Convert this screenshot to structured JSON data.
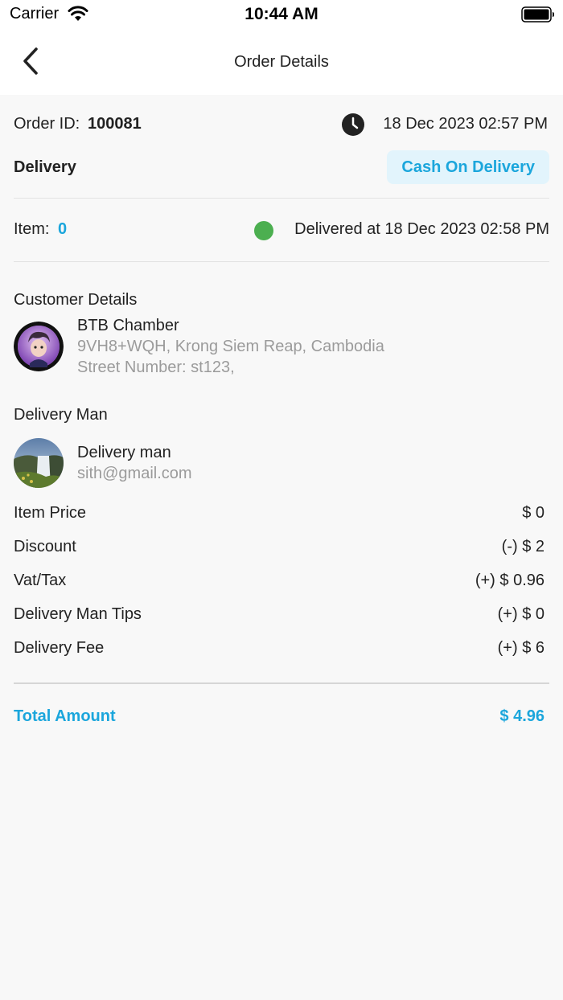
{
  "status_bar": {
    "carrier": "Carrier",
    "time": "10:44 AM",
    "wifi_icon": "wifi-icon",
    "battery_icon": "battery-icon"
  },
  "header": {
    "title": "Order Details",
    "back_icon": "chevron-left-icon"
  },
  "order": {
    "id_label": "Order ID:",
    "id_value": "100081",
    "clock_icon": "clock-icon",
    "datetime": "18 Dec 2023  02:57 PM",
    "delivery_type": "Delivery",
    "payment_method": "Cash On Delivery",
    "items_label": "Item:",
    "items_count": "0",
    "delivered_text": "Delivered at 18 Dec 2023  02:58 PM"
  },
  "customer": {
    "section_title": "Customer Details",
    "name": "BTB Chamber",
    "address": "9VH8+WQH, Krong Siem Reap, Cambodia",
    "street": "Street Number: st123,"
  },
  "delivery_man": {
    "section_title": "Delivery Man",
    "name": "Delivery man",
    "email": "sith@gmail.com"
  },
  "pricing": {
    "rows": [
      {
        "label": "Item Price",
        "value": "$ 0"
      },
      {
        "label": "Discount",
        "value": "(-) $ 2"
      },
      {
        "label": "Vat/Tax",
        "value": "(+) $ 0.96"
      },
      {
        "label": "Delivery Man Tips",
        "value": "(+) $ 0"
      },
      {
        "label": "Delivery Fee",
        "value": "(+) $ 6"
      }
    ],
    "total_label": "Total Amount",
    "total_value": "$ 4.96"
  },
  "colors": {
    "accent": "#1ba6dc",
    "badge_bg": "#e2f4fc",
    "delivered_status": "#4caf50",
    "background": "#f8f8f8"
  }
}
